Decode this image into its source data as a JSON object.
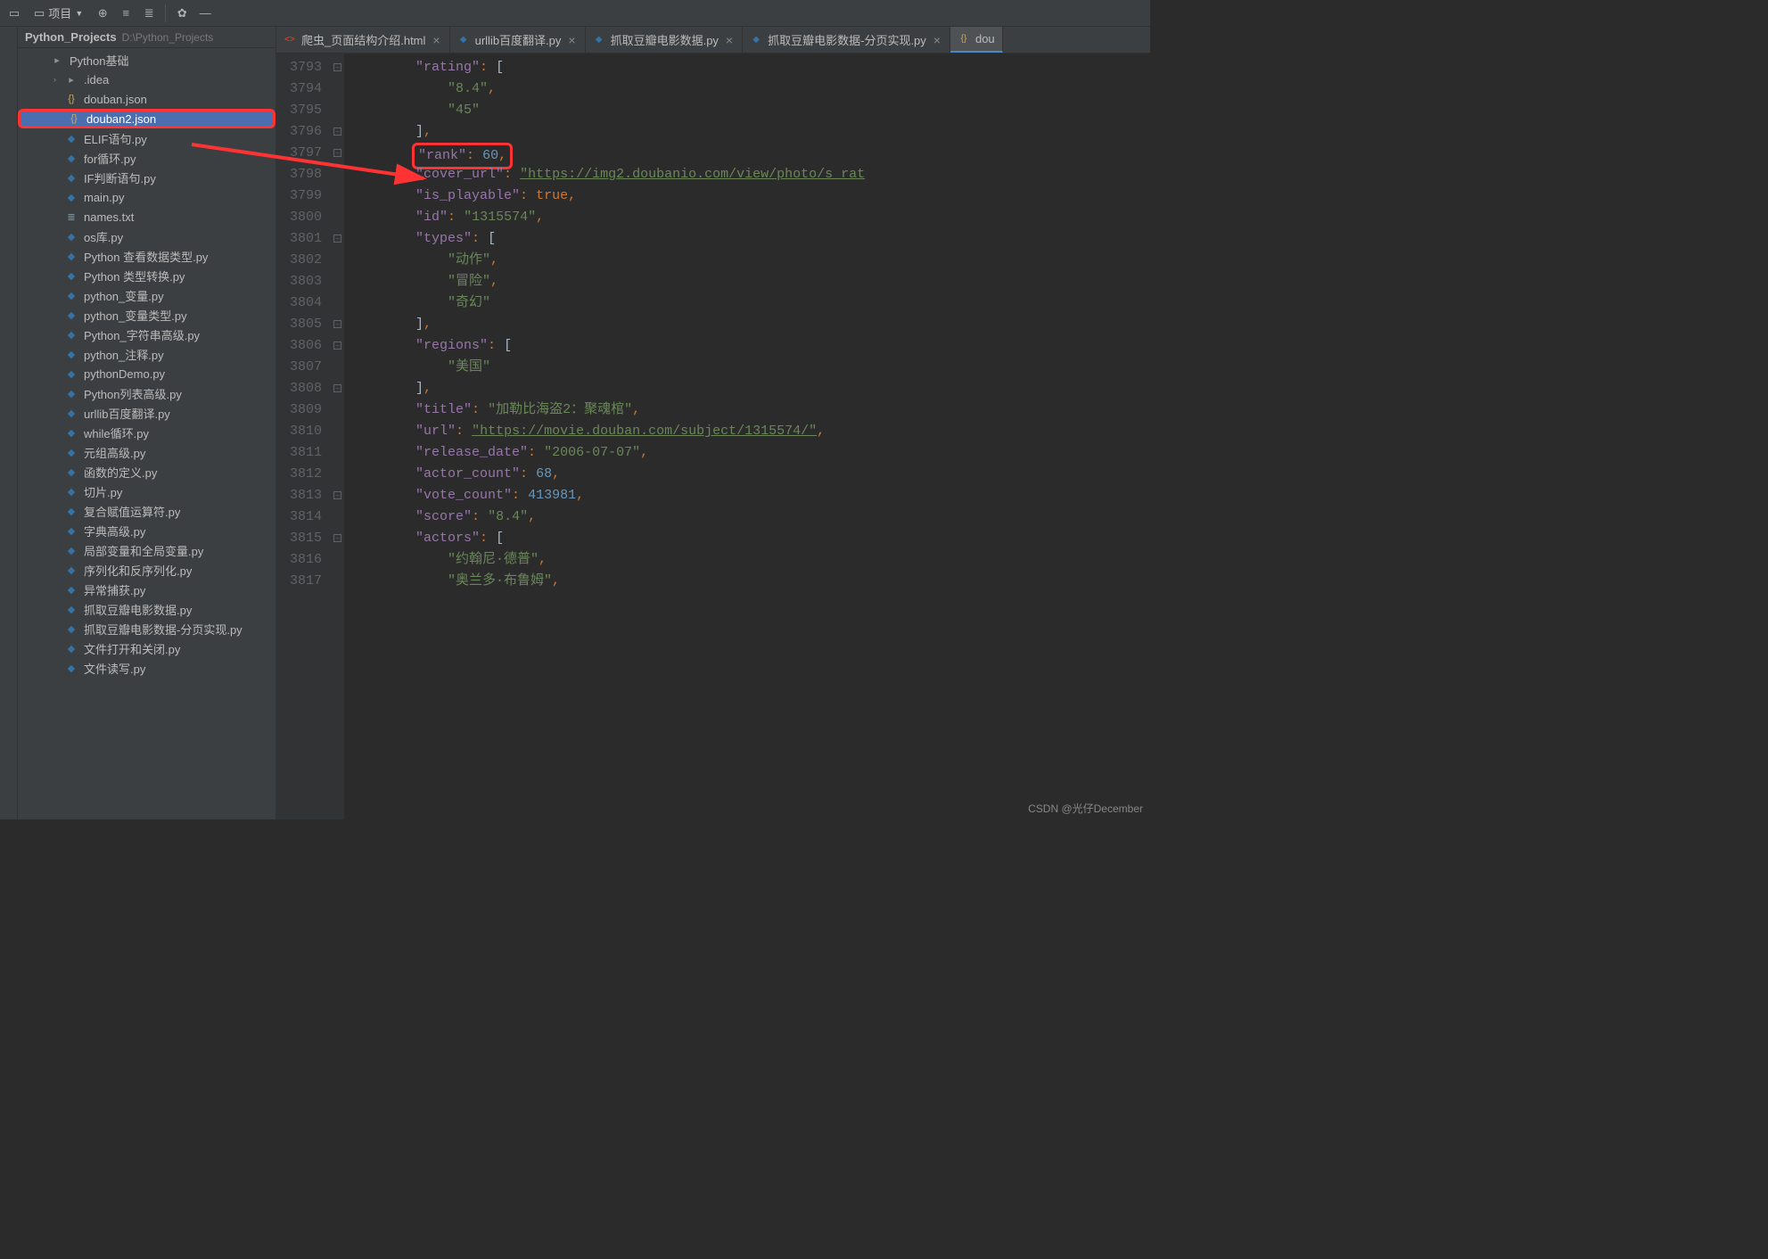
{
  "toolbar": {
    "project_label": "项目"
  },
  "project": {
    "name": "Python_Projects",
    "path": "D:\\Python_Projects"
  },
  "tree": [
    {
      "label": "Python基础",
      "icon": "folder",
      "indent": 1,
      "expandable": false
    },
    {
      "label": ".idea",
      "icon": "folder",
      "indent": 2,
      "expandable": true
    },
    {
      "label": "douban.json",
      "icon": "json",
      "indent": 2
    },
    {
      "label": "douban2.json",
      "icon": "json",
      "indent": 2,
      "selected": true,
      "highlighted": true
    },
    {
      "label": "ELIF语句.py",
      "icon": "py",
      "indent": 2
    },
    {
      "label": "for循环.py",
      "icon": "py",
      "indent": 2
    },
    {
      "label": "IF判断语句.py",
      "icon": "py",
      "indent": 2
    },
    {
      "label": "main.py",
      "icon": "py",
      "indent": 2
    },
    {
      "label": "names.txt",
      "icon": "txt",
      "indent": 2
    },
    {
      "label": "os库.py",
      "icon": "py",
      "indent": 2
    },
    {
      "label": "Python 查看数据类型.py",
      "icon": "py",
      "indent": 2
    },
    {
      "label": "Python 类型转换.py",
      "icon": "py",
      "indent": 2
    },
    {
      "label": "python_变量.py",
      "icon": "py",
      "indent": 2
    },
    {
      "label": "python_变量类型.py",
      "icon": "py",
      "indent": 2
    },
    {
      "label": "Python_字符串高级.py",
      "icon": "py",
      "indent": 2
    },
    {
      "label": "python_注释.py",
      "icon": "py",
      "indent": 2
    },
    {
      "label": "pythonDemo.py",
      "icon": "py",
      "indent": 2
    },
    {
      "label": "Python列表高级.py",
      "icon": "py",
      "indent": 2
    },
    {
      "label": "urllib百度翻译.py",
      "icon": "py",
      "indent": 2
    },
    {
      "label": "while循环.py",
      "icon": "py",
      "indent": 2
    },
    {
      "label": "元组高级.py",
      "icon": "py",
      "indent": 2
    },
    {
      "label": "函数的定义.py",
      "icon": "py",
      "indent": 2
    },
    {
      "label": "切片.py",
      "icon": "py",
      "indent": 2
    },
    {
      "label": "复合赋值运算符.py",
      "icon": "py",
      "indent": 2
    },
    {
      "label": "字典高级.py",
      "icon": "py",
      "indent": 2
    },
    {
      "label": "局部变量和全局变量.py",
      "icon": "py",
      "indent": 2
    },
    {
      "label": "序列化和反序列化.py",
      "icon": "py",
      "indent": 2
    },
    {
      "label": "异常捕获.py",
      "icon": "py",
      "indent": 2
    },
    {
      "label": "抓取豆瓣电影数据.py",
      "icon": "py",
      "indent": 2
    },
    {
      "label": "抓取豆瓣电影数据-分页实现.py",
      "icon": "py",
      "indent": 2
    },
    {
      "label": "文件打开和关闭.py",
      "icon": "py",
      "indent": 2
    },
    {
      "label": "文件读写.py",
      "icon": "py",
      "indent": 2
    }
  ],
  "tabs": [
    {
      "label": "爬虫_页面结构介绍.html",
      "icon": "html"
    },
    {
      "label": "urllib百度翻译.py",
      "icon": "py"
    },
    {
      "label": "抓取豆瓣电影数据.py",
      "icon": "py"
    },
    {
      "label": "抓取豆瓣电影数据-分页实现.py",
      "icon": "py"
    },
    {
      "label": "dou",
      "icon": "json",
      "active": true
    }
  ],
  "gutter_start": 3793,
  "gutter_end": 3817,
  "code": {
    "rating_key": "\"rating\"",
    "rating_v1": "\"8.4\"",
    "rating_v2": "\"45\"",
    "rank_key": "\"rank\"",
    "rank_val": "60",
    "cover_key": "\"cover_url\"",
    "cover_val": "\"https://img2.doubanio.com/view/photo/s_rat",
    "playable_key": "\"is_playable\"",
    "playable_val": "true",
    "id_key": "\"id\"",
    "id_val": "\"1315574\"",
    "types_key": "\"types\"",
    "type1": "\"动作\"",
    "type2": "\"冒险\"",
    "type3": "\"奇幻\"",
    "regions_key": "\"regions\"",
    "region1": "\"美国\"",
    "title_key": "\"title\"",
    "title_val": "\"加勒比海盗2：聚魂棺\"",
    "url_key": "\"url\"",
    "url_val": "\"https://movie.douban.com/subject/1315574/\"",
    "release_key": "\"release_date\"",
    "release_val": "\"2006-07-07\"",
    "actor_count_key": "\"actor_count\"",
    "actor_count_val": "68",
    "vote_key": "\"vote_count\"",
    "vote_val": "413981",
    "score_key": "\"score\"",
    "score_val": "\"8.4\"",
    "actors_key": "\"actors\"",
    "actor1": "\"约翰尼·德普\"",
    "actor2": "\"奥兰多·布鲁姆\""
  },
  "watermark": "CSDN @光仔December"
}
